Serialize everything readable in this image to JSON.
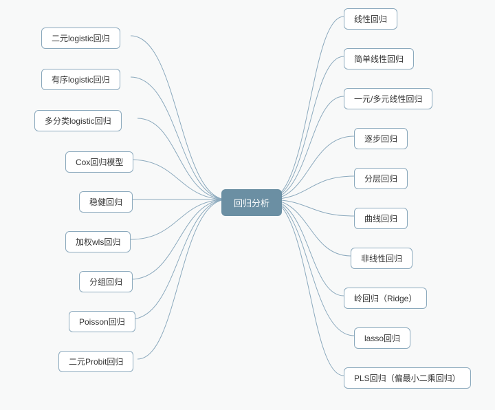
{
  "center": {
    "label": "回归分析"
  },
  "left_nodes": [
    {
      "label": "二元logistic回归"
    },
    {
      "label": "有序logistic回归"
    },
    {
      "label": "多分类logistic回归"
    },
    {
      "label": "Cox回归模型"
    },
    {
      "label": "稳健回归"
    },
    {
      "label": "加权wls回归"
    },
    {
      "label": "分组回归"
    },
    {
      "label": "Poisson回归"
    },
    {
      "label": "二元Probit回归"
    }
  ],
  "right_nodes": [
    {
      "label": "线性回归"
    },
    {
      "label": "简单线性回归"
    },
    {
      "label": "一元/多元线性回归"
    },
    {
      "label": "逐步回归"
    },
    {
      "label": "分层回归"
    },
    {
      "label": "曲线回归"
    },
    {
      "label": "非线性回归"
    },
    {
      "label": "岭回归（Ridge）"
    },
    {
      "label": "lasso回归"
    },
    {
      "label": "PLS回归（偏最小二乘回归）"
    }
  ],
  "chart_data": {
    "type": "diagram",
    "title": "回归分析",
    "structure": "mindmap",
    "center": "回归分析",
    "branches": {
      "left": [
        "二元logistic回归",
        "有序logistic回归",
        "多分类logistic回归",
        "Cox回归模型",
        "稳健回归",
        "加权wls回归",
        "分组回归",
        "Poisson回归",
        "二元Probit回归"
      ],
      "right": [
        "线性回归",
        "简单线性回归",
        "一元/多元线性回归",
        "逐步回归",
        "分层回归",
        "曲线回归",
        "非线性回归",
        "岭回归（Ridge）",
        "lasso回归",
        "PLS回归（偏最小二乘回归）"
      ]
    }
  }
}
